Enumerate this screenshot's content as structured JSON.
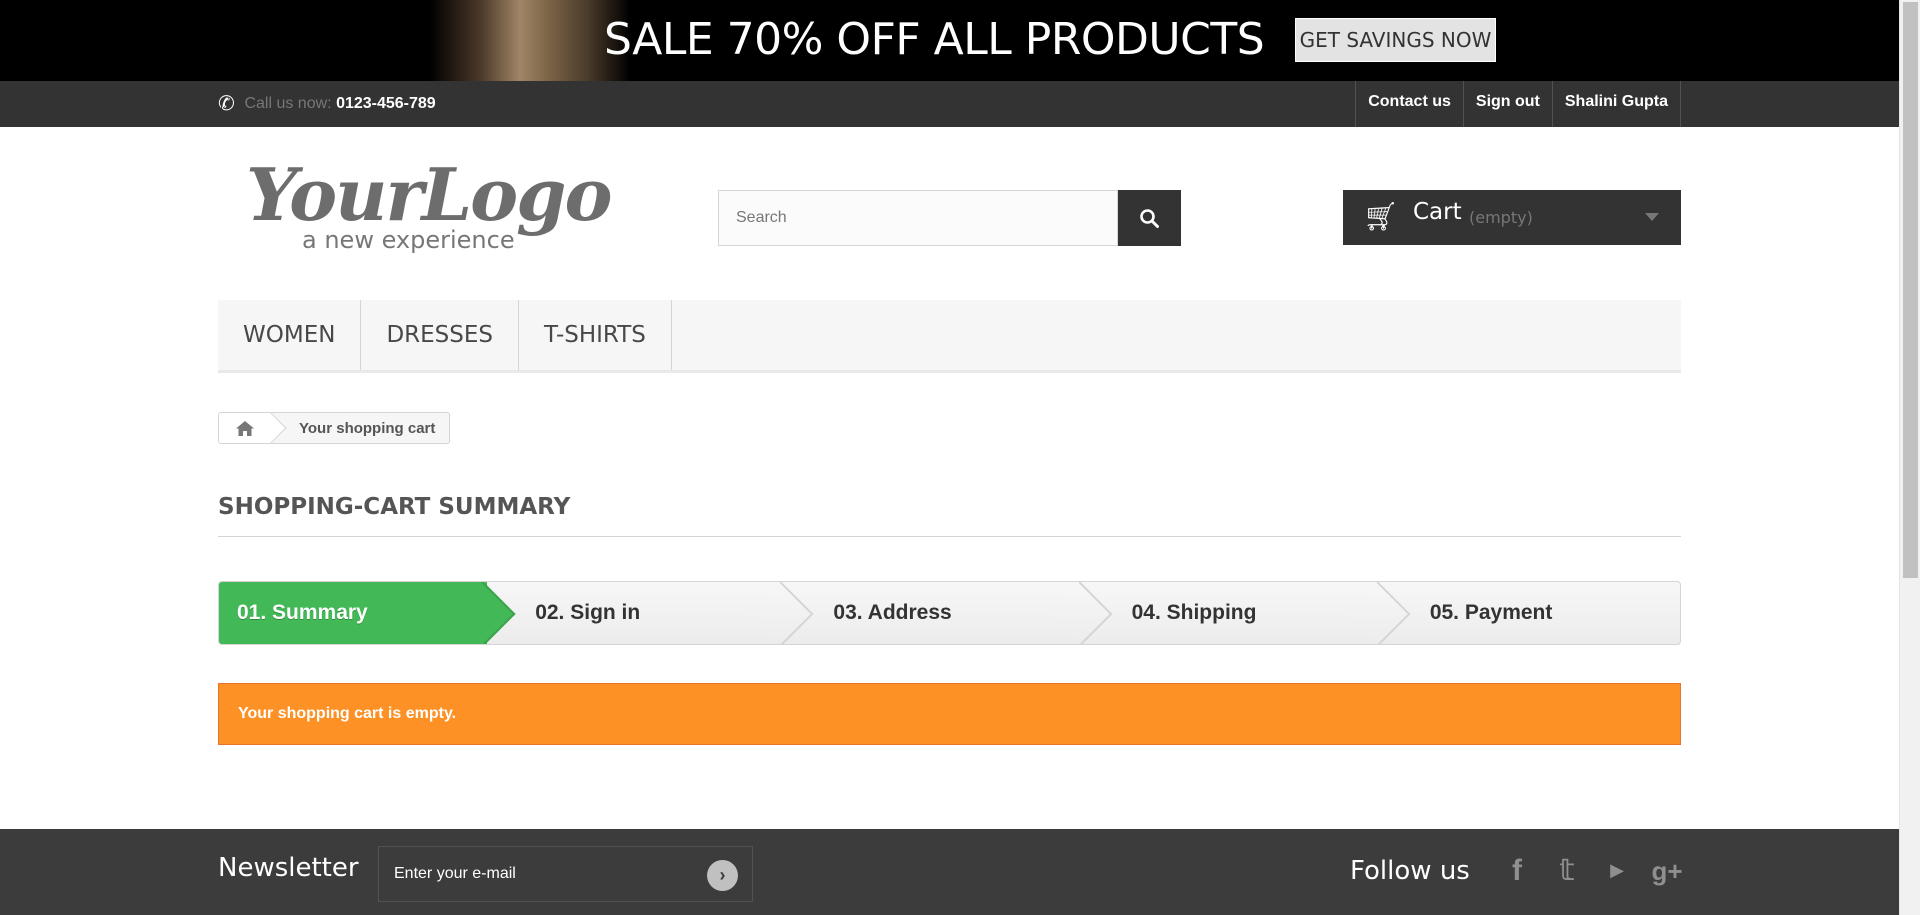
{
  "banner": {
    "headline": "SALE 70% OFF ALL PRODUCTS",
    "cta": "GET SAVINGS NOW"
  },
  "topnav": {
    "call_label": "Call us now:",
    "phone": "0123-456-789",
    "links": [
      "Contact us",
      "Sign out",
      "Shalini Gupta"
    ]
  },
  "logo": {
    "main": "YourLogo",
    "tagline": "a new experience"
  },
  "search": {
    "placeholder": "Search",
    "value": ""
  },
  "cart": {
    "label": "Cart",
    "status": "(empty)"
  },
  "menu": [
    "WOMEN",
    "DRESSES",
    "T-SHIRTS"
  ],
  "breadcrumb": {
    "current": "Your shopping cart"
  },
  "page": {
    "heading": "Shopping-cart summary"
  },
  "steps": [
    {
      "label": "01. Summary",
      "active": true
    },
    {
      "label": "02. Sign in",
      "active": false
    },
    {
      "label": "03. Address",
      "active": false
    },
    {
      "label": "04. Shipping",
      "active": false
    },
    {
      "label": "05. Payment",
      "active": false
    }
  ],
  "alert": {
    "message": "Your shopping cart is empty."
  },
  "footer": {
    "newsletter_title": "Newsletter",
    "newsletter_placeholder": "Enter your e-mail",
    "follow_title": "Follow us",
    "social_icons": [
      "facebook-icon",
      "twitter-icon",
      "youtube-icon",
      "google-plus-icon"
    ]
  },
  "colors": {
    "dark": "#333333",
    "step_active": "#42b856",
    "alert": "#fe9126",
    "footer": "#3c3c3c"
  }
}
